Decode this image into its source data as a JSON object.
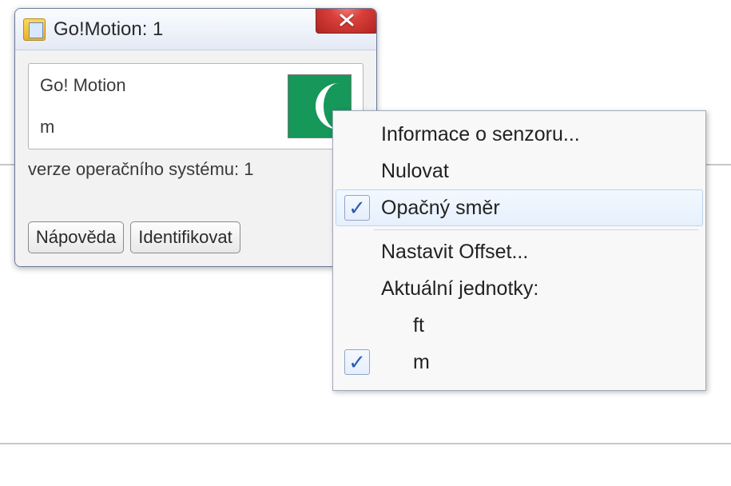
{
  "window": {
    "title": "Go!Motion: 1",
    "sensor_name": "Go! Motion",
    "sensor_unit": "m",
    "os_label": "verze operačního systému: 1",
    "buttons": {
      "help": "Nápověda",
      "identify": "Identifikovat"
    }
  },
  "menu": {
    "items": [
      {
        "label": "Informace o senzoru...",
        "checked": false,
        "hover": false
      },
      {
        "label": "Nulovat",
        "checked": false,
        "hover": false
      },
      {
        "label": "Opačný směr",
        "checked": true,
        "hover": true
      },
      {
        "label": "Nastavit Offset...",
        "checked": false,
        "hover": false
      },
      {
        "label": "Aktuální jednotky:",
        "checked": false,
        "hover": false,
        "header": true
      }
    ],
    "units": [
      {
        "label": "ft",
        "checked": false
      },
      {
        "label": "m",
        "checked": true
      }
    ]
  }
}
